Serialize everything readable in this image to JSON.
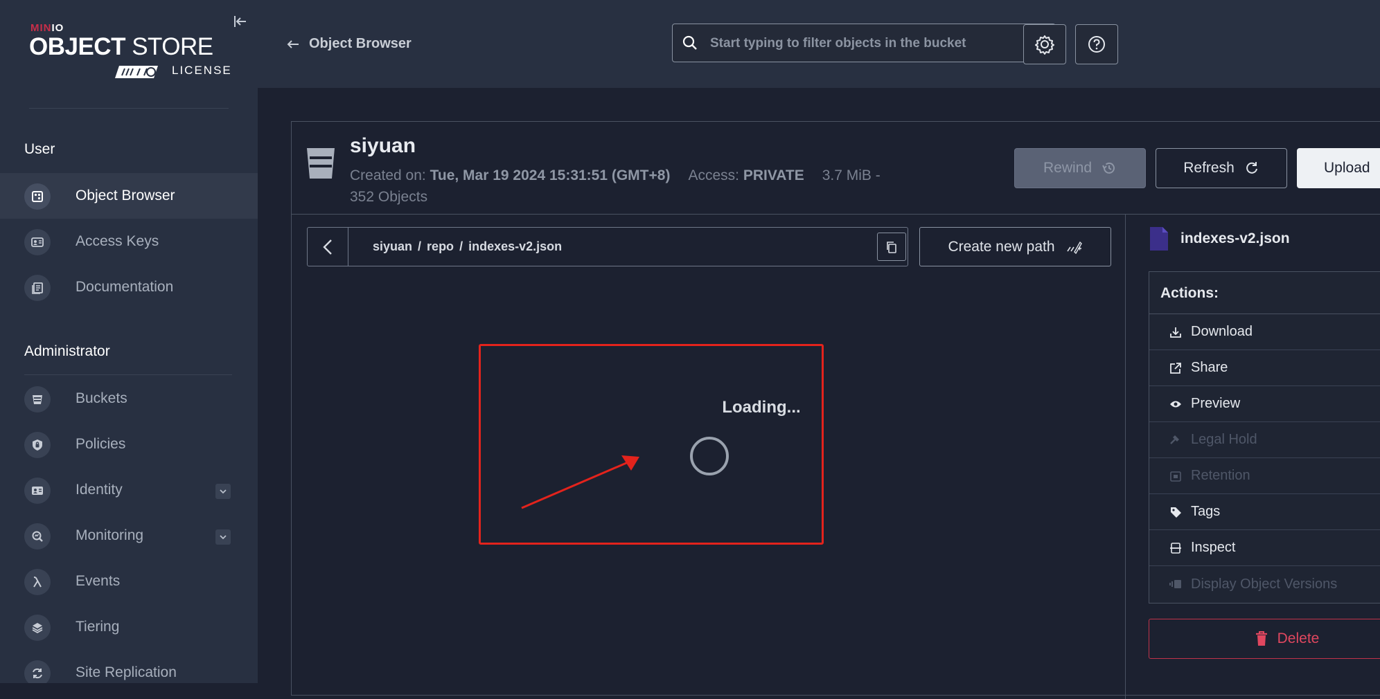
{
  "sidebar": {
    "logo": {
      "brand_min": "MIN",
      "brand_io": "IO",
      "product_bold": "OBJECT",
      "product_light": " STORE",
      "license": "LICENSE"
    },
    "sections": {
      "user": "User",
      "admin": "Administrator"
    },
    "user_items": [
      {
        "label": "Object Browser",
        "icon": "object-browser-icon",
        "active": true
      },
      {
        "label": "Access Keys",
        "icon": "access-keys-icon"
      },
      {
        "label": "Documentation",
        "icon": "documentation-icon"
      }
    ],
    "admin_items": [
      {
        "label": "Buckets",
        "icon": "bucket-icon"
      },
      {
        "label": "Policies",
        "icon": "shield-icon"
      },
      {
        "label": "Identity",
        "icon": "id-card-icon",
        "expandable": true
      },
      {
        "label": "Monitoring",
        "icon": "magnifier-icon",
        "expandable": true
      },
      {
        "label": "Events",
        "icon": "lambda-icon"
      },
      {
        "label": "Tiering",
        "icon": "layers-icon"
      },
      {
        "label": "Site Replication",
        "icon": "sync-icon"
      }
    ]
  },
  "header": {
    "back_label": "Object Browser",
    "search_placeholder": "Start typing to filter objects in the bucket"
  },
  "bucket": {
    "name": "siyuan",
    "created_label": "Created on:",
    "created_value": "Tue, Mar 19 2024 15:31:51 (GMT+8)",
    "access_label": "Access:",
    "access_value": "PRIVATE",
    "size": "3.7 MiB -",
    "objects": "352 Objects",
    "buttons": {
      "rewind": "Rewind",
      "refresh": "Refresh",
      "upload": "Upload"
    }
  },
  "breadcrumb": {
    "parts": [
      "siyuan",
      "repo",
      "indexes-v2.json"
    ],
    "new_path": "Create new path"
  },
  "loading": {
    "text": "Loading..."
  },
  "details": {
    "file_name": "indexes-v2.json",
    "actions_title": "Actions:",
    "actions": [
      {
        "label": "Download",
        "icon": "download-icon",
        "enabled": true
      },
      {
        "label": "Share",
        "icon": "share-icon",
        "enabled": true
      },
      {
        "label": "Preview",
        "icon": "eye-icon",
        "enabled": true
      },
      {
        "label": "Legal Hold",
        "icon": "gavel-icon",
        "enabled": false
      },
      {
        "label": "Retention",
        "icon": "retention-icon",
        "enabled": false
      },
      {
        "label": "Tags",
        "icon": "tag-icon",
        "enabled": true
      },
      {
        "label": "Inspect",
        "icon": "inspect-icon",
        "enabled": true
      },
      {
        "label": "Display Object Versions",
        "icon": "versions-icon",
        "enabled": false
      }
    ],
    "delete_label": "Delete"
  },
  "colors": {
    "sidebar_bg": "#283041",
    "main_bg": "#1c2130",
    "annotation_red": "#e3231c",
    "delete_red": "#e0475f",
    "logo_red": "#c72e49"
  }
}
